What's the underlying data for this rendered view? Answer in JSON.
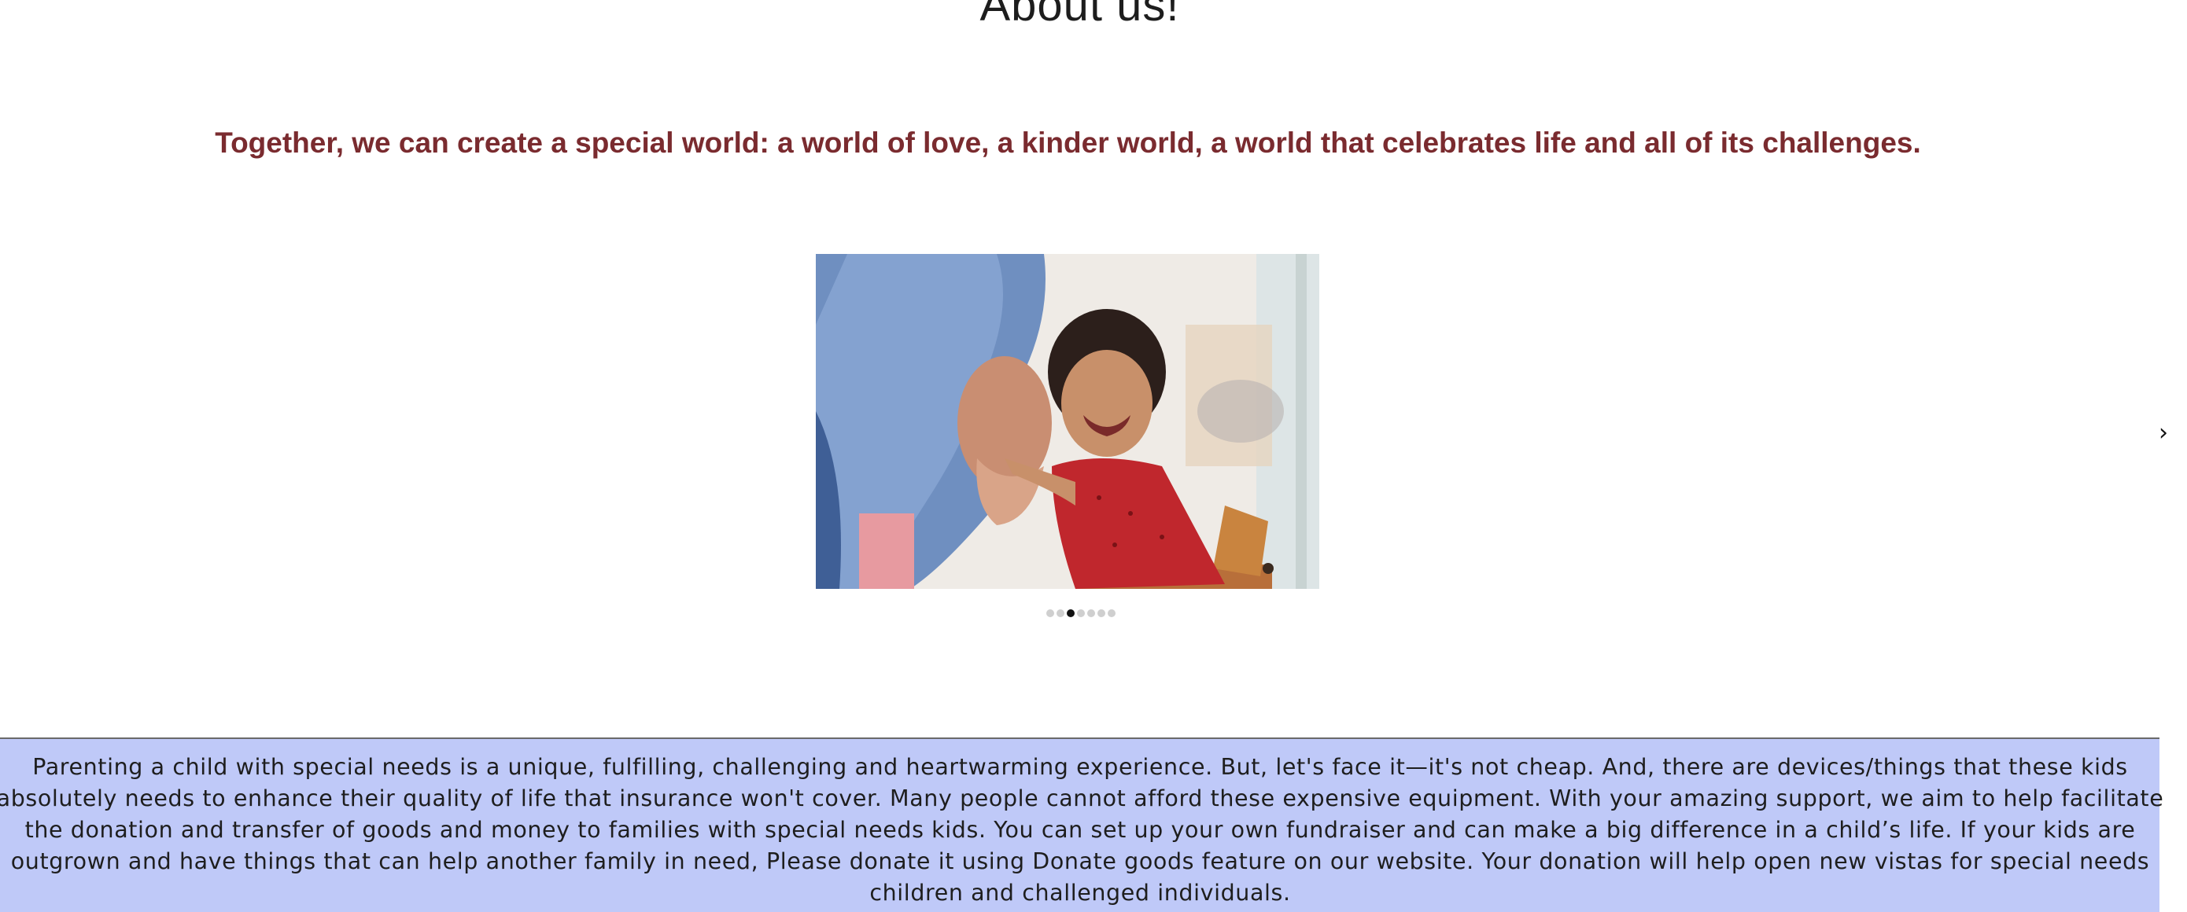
{
  "about": {
    "heading": "About us!",
    "tagline": "Together, we can create a special world: a world of love, a kinder world, a world that celebrates life and all of its challenges."
  },
  "slider": {
    "image_alt": "Mother in a blue headscarf laughing with her daughter in a red dress",
    "next_icon": "chevron-right-icon",
    "dots_count": 7,
    "active_dot": 3
  },
  "info": {
    "text": "Parenting a child with special needs is a unique, fulfilling, challenging and heartwarming experience. But, let's face it—it's not cheap. And, there are devices/things that these kids absolutely needs to enhance their quality of life that insurance won't cover. Many people cannot afford these expensive equipment. With your amazing support, we aim to help facilitate the donation and transfer of goods and money to families with special needs kids. You can set up your own fundraiser and can make a big difference in a child’s life. If your kids are outgrown and have things that can help another family in need, Please donate it using Donate goods feature on our website. Your donation will help open new vistas for special needs children and challenged individuals."
  },
  "colors": {
    "tagline": "#7a2b2f",
    "info_background": "#bfc9f8"
  }
}
